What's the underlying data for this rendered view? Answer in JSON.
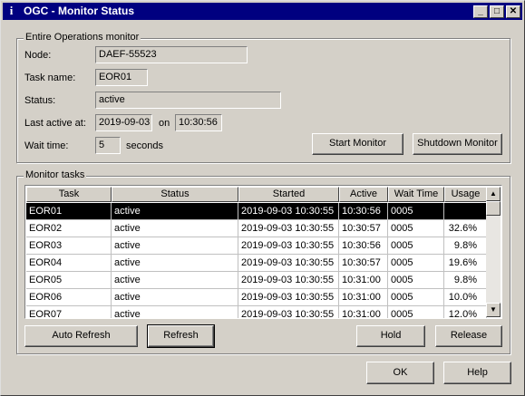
{
  "window": {
    "title": "OGC - Monitor Status",
    "app_icon_glyph": "i",
    "minimize_glyph": "_",
    "maximize_glyph": "□",
    "close_glyph": "✕"
  },
  "ops": {
    "group_label": "Entire Operations monitor",
    "node_label": "Node:",
    "node_value": "DAEF-55523",
    "taskname_label": "Task name:",
    "taskname_value": "EOR01",
    "status_label": "Status:",
    "status_value": "active",
    "lastactive_label": "Last active at:",
    "lastactive_date": "2019-09-03",
    "on_label": "on",
    "lastactive_time": "10:30:56",
    "wait_label": "Wait time:",
    "wait_value": "5",
    "seconds_label": "seconds",
    "start_button": "Start Monitor",
    "shutdown_button": "Shutdown Monitor"
  },
  "tasks": {
    "group_label": "Monitor tasks",
    "columns": [
      "Task",
      "Status",
      "Started",
      "Active",
      "Wait Time",
      "Usage"
    ],
    "rows": [
      [
        "EOR01",
        "active",
        "2019-09-03 10:30:55",
        "10:30:56",
        "0005",
        ""
      ],
      [
        "EOR02",
        "active",
        "2019-09-03 10:30:55",
        "10:30:57",
        "0005",
        "32.6%"
      ],
      [
        "EOR03",
        "active",
        "2019-09-03 10:30:55",
        "10:30:56",
        "0005",
        "9.8%"
      ],
      [
        "EOR04",
        "active",
        "2019-09-03 10:30:55",
        "10:30:57",
        "0005",
        "19.6%"
      ],
      [
        "EOR05",
        "active",
        "2019-09-03 10:30:55",
        "10:31:00",
        "0005",
        "9.8%"
      ],
      [
        "EOR06",
        "active",
        "2019-09-03 10:30:55",
        "10:31:00",
        "0005",
        "10.0%"
      ],
      [
        "EOR07",
        "active",
        "2019-09-03 10:30:55",
        "10:31:00",
        "0005",
        "12.0%"
      ]
    ],
    "selected_row": 0,
    "scroll_up_glyph": "▲",
    "scroll_down_glyph": "▼",
    "auto_refresh_button": "Auto Refresh",
    "refresh_button": "Refresh",
    "hold_button": "Hold",
    "release_button": "Release"
  },
  "footer": {
    "ok_button": "OK",
    "help_button": "Help"
  }
}
